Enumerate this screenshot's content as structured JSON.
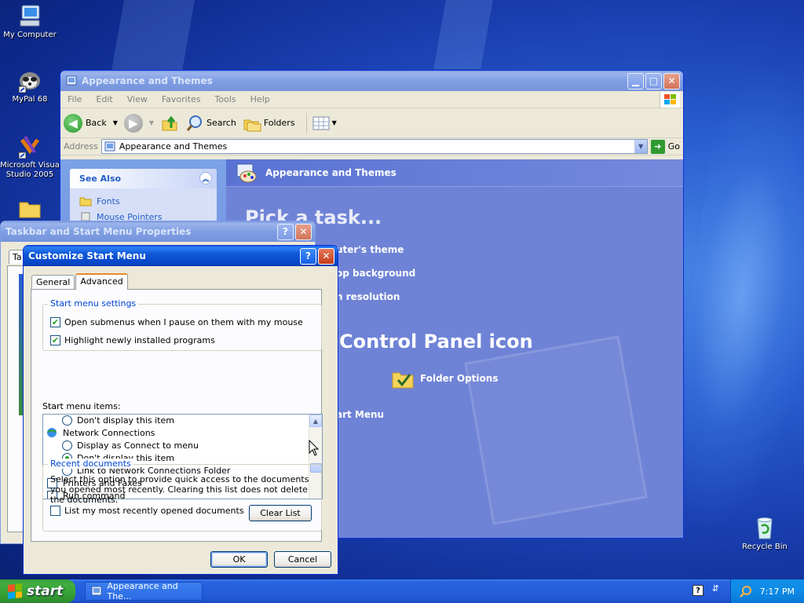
{
  "desktop": {
    "icons": [
      {
        "label": "My Computer"
      },
      {
        "label": "MyPal 68"
      },
      {
        "label": "Microsoft Visua Studio 2005"
      },
      {
        "label": "Recycle Bin"
      }
    ]
  },
  "explorer": {
    "title": "Appearance and Themes",
    "menu": [
      "File",
      "Edit",
      "View",
      "Favorites",
      "Tools",
      "Help"
    ],
    "toolbar": {
      "back": "Back",
      "search": "Search",
      "folders": "Folders"
    },
    "address": {
      "label": "Address",
      "value": "Appearance and Themes",
      "go": "Go"
    },
    "see_also": {
      "title": "See Also",
      "links": [
        "Fonts",
        "Mouse Pointers"
      ]
    },
    "header": "Appearance and Themes",
    "pick_task": "Pick a task...",
    "tasks": [
      "uter's theme",
      "op background",
      "n resolution"
    ],
    "control_panel_heading": "Control Panel icon",
    "folder_options": "Folder Options",
    "start_menu_link": "art Menu"
  },
  "taskbar_props": {
    "title": "Taskbar and Start Menu Properties",
    "tab_stub": "Ta"
  },
  "customize": {
    "title": "Customize Start Menu",
    "tabs": [
      "General",
      "Advanced"
    ],
    "settings_group": "Start menu settings",
    "settings": [
      {
        "label": "Open submenus when I pause on them with my mouse",
        "checked": true
      },
      {
        "label": "Highlight newly installed programs",
        "checked": true
      }
    ],
    "items_label": "Start menu items:",
    "items": [
      {
        "label": "Don't display this item",
        "type": "radio",
        "selected": false
      },
      {
        "label": "Network Connections",
        "type": "heading"
      },
      {
        "label": "Display as Connect to menu",
        "type": "radio",
        "selected": false
      },
      {
        "label": "Don't display this item",
        "type": "radio",
        "selected": true
      },
      {
        "label": "Link to Network Connections Folder",
        "type": "radio",
        "selected": false
      },
      {
        "label": "Printers and Faxes",
        "type": "check",
        "checked": false
      },
      {
        "label": "Run command",
        "type": "check",
        "checked": false
      }
    ],
    "recent_group": "Recent documents",
    "recent_desc": "Select this option to provide quick access to the documents you opened most recently.  Clearing this list does not delete the documents.",
    "recent_check": "List my most recently opened documents",
    "clear_list": "Clear List",
    "ok": "OK",
    "cancel": "Cancel"
  },
  "taskbar": {
    "start": "start",
    "task": "Appearance and The...",
    "clock": "7:17 PM"
  },
  "colors": {
    "accent": "#0a5ddd",
    "start_green": "#3fae3f",
    "panel_blue": "#6f83d6"
  }
}
